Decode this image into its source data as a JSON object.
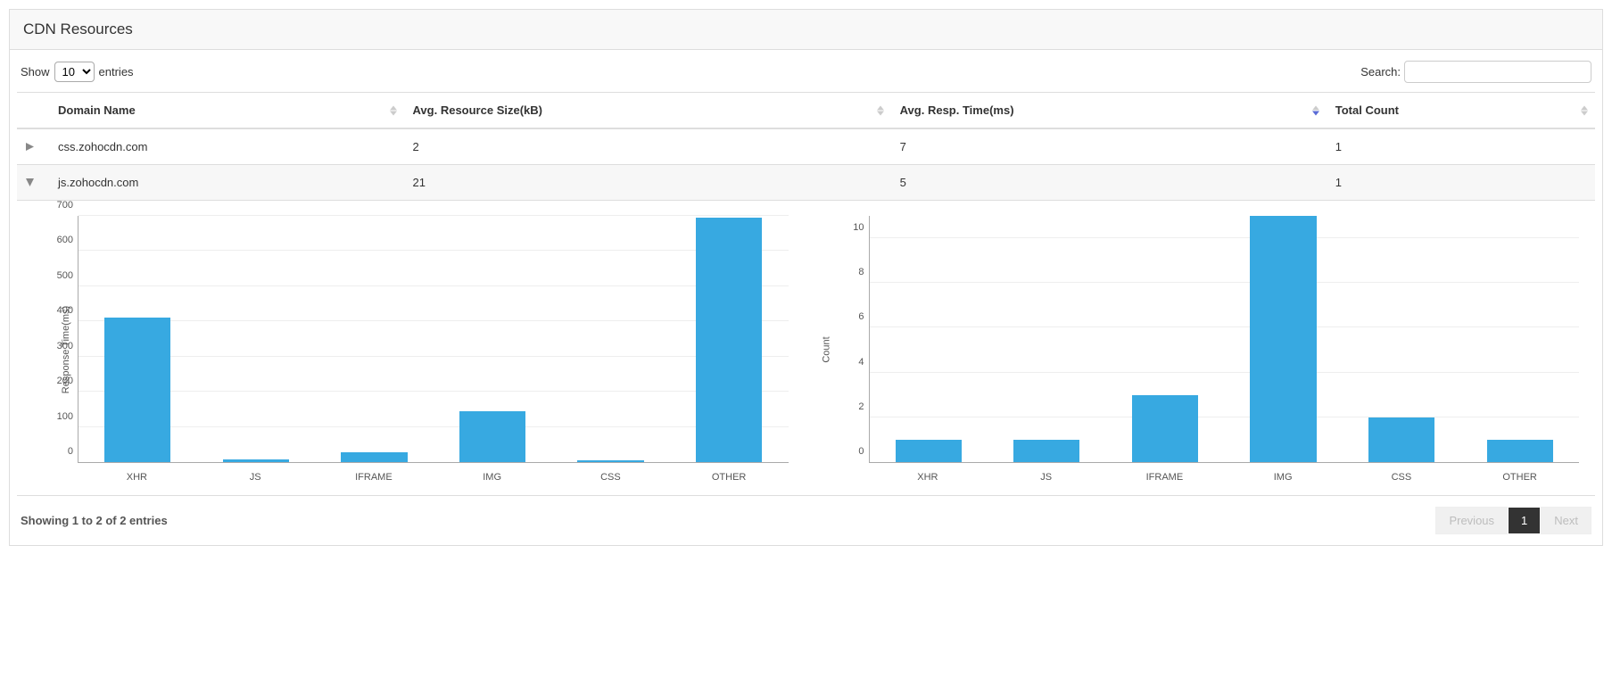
{
  "panel": {
    "title": "CDN Resources"
  },
  "controls": {
    "show_label_pre": "Show",
    "show_label_post": "entries",
    "show_value": "10",
    "search_label": "Search:",
    "search_value": ""
  },
  "table": {
    "columns": {
      "c1": "Domain Name",
      "c2": "Avg. Resource Size(kB)",
      "c3": "Avg. Resp. Time(ms)",
      "c4": "Total Count"
    },
    "sorted_column": "c3",
    "sort_dir": "desc",
    "rows": [
      {
        "expand": "collapsed",
        "domain": "css.zohocdn.com",
        "size": "2",
        "resp": "7",
        "count": "1"
      },
      {
        "expand": "expanded",
        "domain": "js.zohocdn.com",
        "size": "21",
        "resp": "5",
        "count": "1"
      }
    ]
  },
  "chart_data": [
    {
      "type": "bar",
      "ylabel": "Response Time(ms)",
      "categories": [
        "XHR",
        "JS",
        "IFRAME",
        "IMG",
        "CSS",
        "OTHER"
      ],
      "values": [
        410,
        8,
        28,
        145,
        5,
        695
      ],
      "ylim": [
        0,
        700
      ],
      "ystep": 100
    },
    {
      "type": "bar",
      "ylabel": "Count",
      "categories": [
        "XHR",
        "JS",
        "IFRAME",
        "IMG",
        "CSS",
        "OTHER"
      ],
      "values": [
        1,
        1,
        3,
        11,
        2,
        1
      ],
      "ylim": [
        0,
        11
      ],
      "ystep": 2
    }
  ],
  "footer": {
    "info": "Showing 1 to 2 of 2 entries",
    "prev": "Previous",
    "page": "1",
    "next": "Next"
  },
  "colors": {
    "bar": "#37a9e1"
  }
}
